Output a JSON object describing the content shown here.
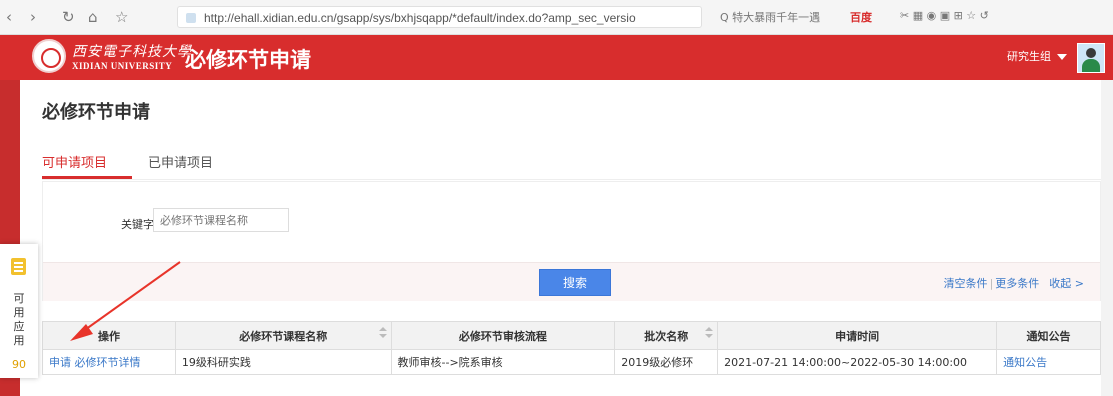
{
  "browser": {
    "url": "http://ehall.xidian.edu.cn/gsapp/sys/bxhjsqapp/*default/index.do?amp_sec_versio",
    "search": "Q 特大暴雨千年一遇",
    "baidu": "百度"
  },
  "header": {
    "logo_cn": "西安電子科技大學",
    "logo_en": "XIDIAN UNIVERSITY",
    "app_title": "必修环节申请",
    "role": "研究生组"
  },
  "page": {
    "title": "必修环节申请"
  },
  "tabs": [
    {
      "label": "可申请项目"
    },
    {
      "label": "已申请项目"
    }
  ],
  "search": {
    "keyword_label": "关键字",
    "keyword_placeholder": "必修环节课程名称",
    "button": "搜索",
    "clear": "清空条件",
    "sep": "|",
    "more": "更多条件",
    "collapse": "收起 >"
  },
  "table": {
    "headers": [
      "操作",
      "必修环节课程名称",
      "必修环节审核流程",
      "批次名称",
      "申请时间",
      "通知公告"
    ],
    "rows": [
      {
        "apply": "申请",
        "detail": "必修环节详情",
        "course": "19级科研实践",
        "flow": "教师审核-->院系审核",
        "batch": "2019级必修环",
        "time": "2021-07-21 14:00:00~2022-05-30 14:00:00",
        "notice": "通知公告"
      }
    ]
  },
  "widget": {
    "text": "可用应用",
    "count": "90"
  },
  "colors": {
    "brand": "#d82d2d",
    "link": "#3a78c8",
    "button": "#4a86e8"
  }
}
